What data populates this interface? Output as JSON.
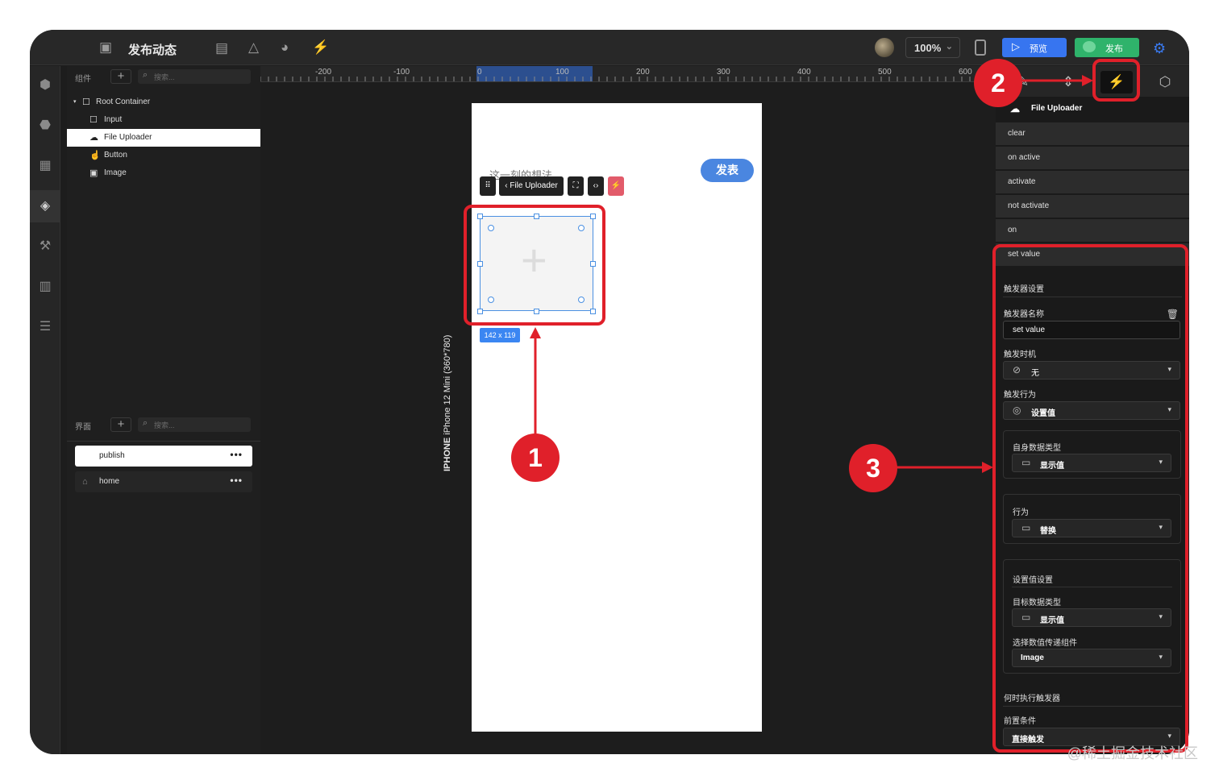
{
  "app": {
    "title": "发布动态",
    "zoom": "100%",
    "preview_label": "预览",
    "publish_label": "发布"
  },
  "components_panel": {
    "label": "组件",
    "search_placeholder": "搜索...",
    "tree": [
      {
        "label": "Root Container",
        "icon": "square-icon"
      },
      {
        "label": "Input",
        "icon": "square-icon"
      },
      {
        "label": "File Uploader",
        "icon": "cloud-icon",
        "selected": true
      },
      {
        "label": "Button",
        "icon": "hand-pointer-icon"
      },
      {
        "label": "Image",
        "icon": "image-icon"
      }
    ]
  },
  "pages_panel": {
    "label": "界面",
    "search_placeholder": "搜索...",
    "pages": [
      {
        "label": "publish",
        "active": true
      },
      {
        "label": "home",
        "active": false
      }
    ],
    "more": "•••"
  },
  "ruler": {
    "labels": [
      "-200",
      "-100",
      "0",
      "100",
      "200",
      "300",
      "400",
      "500",
      "600"
    ]
  },
  "canvas": {
    "phone_placeholder": "这一刻的想法...",
    "post_button": "发表",
    "device_name": "iPhone 12 Mini (360*780)",
    "device_type": "IPHONE",
    "selection_toolbar_label": "File Uploader",
    "size_label": "142 x 119"
  },
  "right_panel": {
    "component_name": "File Uploader",
    "events": [
      "clear",
      "on active",
      "activate",
      "not activate",
      "on",
      "set value"
    ],
    "trigger_settings_title": "触发器设置",
    "trigger_name_label": "触发器名称",
    "trigger_name_value": "set value",
    "trigger_timing_label": "触发时机",
    "trigger_timing_value": "无",
    "trigger_action_label": "触发行为",
    "trigger_action_value": "设置值",
    "self_data_type_label": "自身数据类型",
    "self_data_type_value": "显示值",
    "behavior_label": "行为",
    "behavior_value": "替换",
    "set_value_settings_label": "设置值设置",
    "target_data_type_label": "目标数据类型",
    "target_data_type_value": "显示值",
    "select_component_label": "选择数值传递组件",
    "select_component_value": "Image",
    "when_execute_label": "何时执行触发器",
    "precondition_label": "前置条件",
    "precondition_value": "直接触发"
  },
  "annotations": {
    "badge_1": "1",
    "badge_2": "2",
    "badge_3": "3",
    "color": "#e0202a"
  },
  "watermark": "@稀土掘金技术社区"
}
